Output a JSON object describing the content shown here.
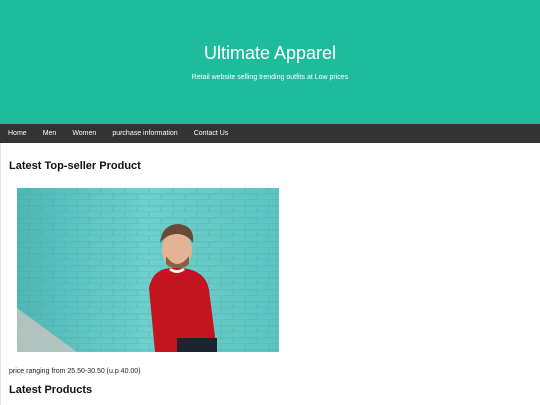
{
  "header": {
    "title": "Ultimate Apparel",
    "tagline": "Retail website selling trending outfits at Low prices",
    "background_color": "#1ebc9c"
  },
  "navbar": {
    "background_color": "#333333",
    "items": [
      {
        "label": "Home"
      },
      {
        "label": "Men"
      },
      {
        "label": "Women"
      },
      {
        "label": "purchase information"
      },
      {
        "label": "Contact Us"
      }
    ]
  },
  "main": {
    "top_seller_heading": "Latest Top-seller Product",
    "product_image": {
      "subject": "man in red sweater leaning on teal brick wall"
    },
    "price_caption": "price ranging from 25.50-30.50 (u.p 40.00)",
    "latest_products_heading": "Latest Products"
  }
}
